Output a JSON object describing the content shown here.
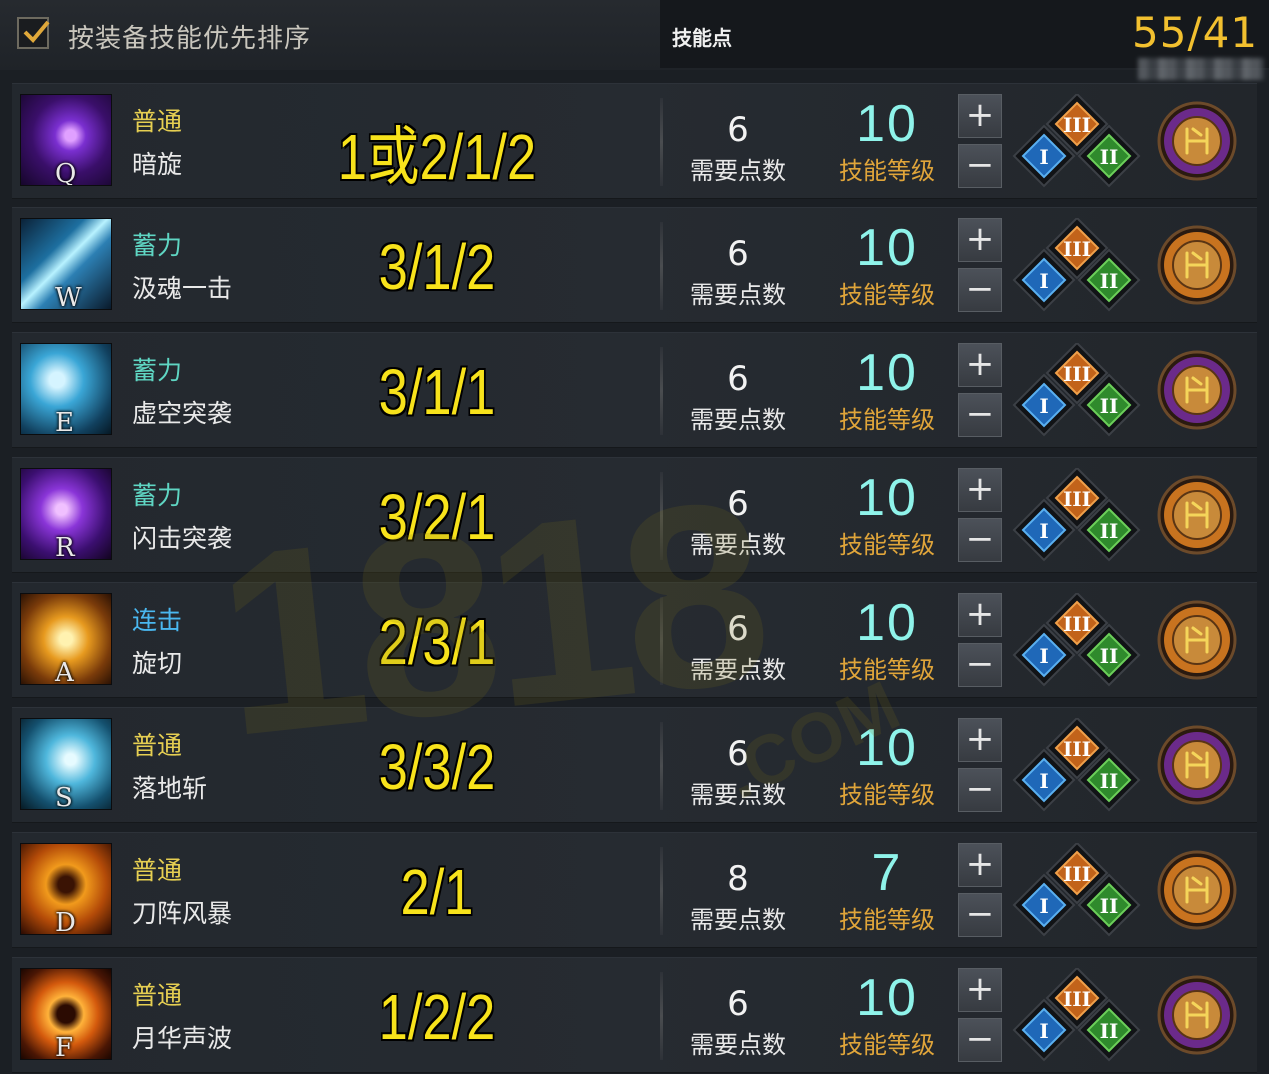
{
  "header": {
    "sort_label": "按装备技能优先排序",
    "sort_checked": true,
    "skill_points_title": "技能点",
    "skill_points_total": "55/41"
  },
  "labels": {
    "points_required": "需要点数",
    "skill_level": "技能等级",
    "plus": "+",
    "minus": "−",
    "tripod_tier_1": "I",
    "tripod_tier_2": "II",
    "tripod_tier_3": "III"
  },
  "watermark": {
    "main": "1818",
    "sub": ".COM"
  },
  "colors": {
    "type_normal": "#e6cf52",
    "type_charge": "#5fd6c3",
    "type_combo": "#4ab8f0",
    "order_text": "#f7e21b",
    "level_num": "#8ff3ea",
    "level_label": "#e0a53a",
    "rune_purple": "#6b2a8a",
    "rune_orange": "#c8731f"
  },
  "skills": [
    {
      "key": "Q",
      "type": "普通",
      "type_kind": "normal",
      "name": "暗旋",
      "order": "1或2/1/2",
      "points": "6",
      "level": "10",
      "icon": "purple-vortex-icon",
      "rune": "purple"
    },
    {
      "key": "W",
      "type": "蓄力",
      "type_kind": "charge",
      "name": "汲魂一击",
      "order": "3/1/2",
      "points": "6",
      "level": "10",
      "icon": "blue-lightning-icon",
      "rune": "orange"
    },
    {
      "key": "E",
      "type": "蓄力",
      "type_kind": "charge",
      "name": "虚空突袭",
      "order": "3/1/1",
      "points": "6",
      "level": "10",
      "icon": "blue-wave-icon",
      "rune": "purple"
    },
    {
      "key": "R",
      "type": "蓄力",
      "type_kind": "charge",
      "name": "闪击突袭",
      "order": "3/2/1",
      "points": "6",
      "level": "10",
      "icon": "purple-slash-icon",
      "rune": "orange"
    },
    {
      "key": "A",
      "type": "连击",
      "type_kind": "combo",
      "name": "旋切",
      "order": "2/3/1",
      "points": "6",
      "level": "10",
      "icon": "golden-spin-icon",
      "rune": "orange"
    },
    {
      "key": "S",
      "type": "普通",
      "type_kind": "normal",
      "name": "落地斩",
      "order": "3/3/2",
      "points": "6",
      "level": "10",
      "icon": "blue-crescent-icon",
      "rune": "purple"
    },
    {
      "key": "D",
      "type": "普通",
      "type_kind": "normal",
      "name": "刀阵风暴",
      "order": "2/1",
      "points": "8",
      "level": "7",
      "icon": "fire-figure-icon",
      "rune": "orange"
    },
    {
      "key": "F",
      "type": "普通",
      "type_kind": "normal",
      "name": "月华声波",
      "order": "1/2/2",
      "points": "6",
      "level": "10",
      "icon": "fire-ring-icon",
      "rune": "purple"
    }
  ]
}
